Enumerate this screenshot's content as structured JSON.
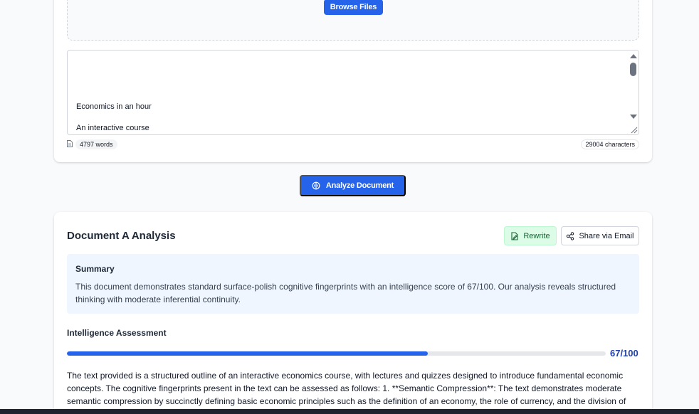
{
  "upload": {
    "browse_label": "Browse Files",
    "textarea_lines": [
      "Economics in an hour",
      "An interactive course"
    ],
    "word_count": "4797 words",
    "char_count": "29004 characters"
  },
  "actions": {
    "analyze_label": "Analyze Document"
  },
  "analysis": {
    "title": "Document A Analysis",
    "rewrite_label": "Rewrite",
    "share_label": "Share via Email",
    "summary_heading": "Summary",
    "summary_text": "This document demonstrates standard surface-polish cognitive fingerprints with an intelligence score of 67/100. Our analysis reveals structured thinking with moderate inferential continuity.",
    "assessment_heading": "Intelligence Assessment",
    "score_label": "67/100",
    "score_fraction": 0.67,
    "body_text": "The text provided is a structured outline of an interactive economics course, with lectures and quizzes designed to introduce fundamental economic concepts. The cognitive fingerprints present in the text can be assessed as follows: 1. **Semantic Compression**: The text demonstrates moderate semantic compression by succinctly defining basic economic principles such as the definition of an economy, the role of currency, and the division of"
  },
  "colors": {
    "primary": "#2563eb",
    "success_bg": "#dcfce7",
    "summary_bg": "#eff6ff",
    "score_text": "#1e40af"
  },
  "icons": {
    "analyze": "brain-icon",
    "rewrite": "file-edit-icon",
    "share": "share-icon",
    "document": "document-icon"
  }
}
